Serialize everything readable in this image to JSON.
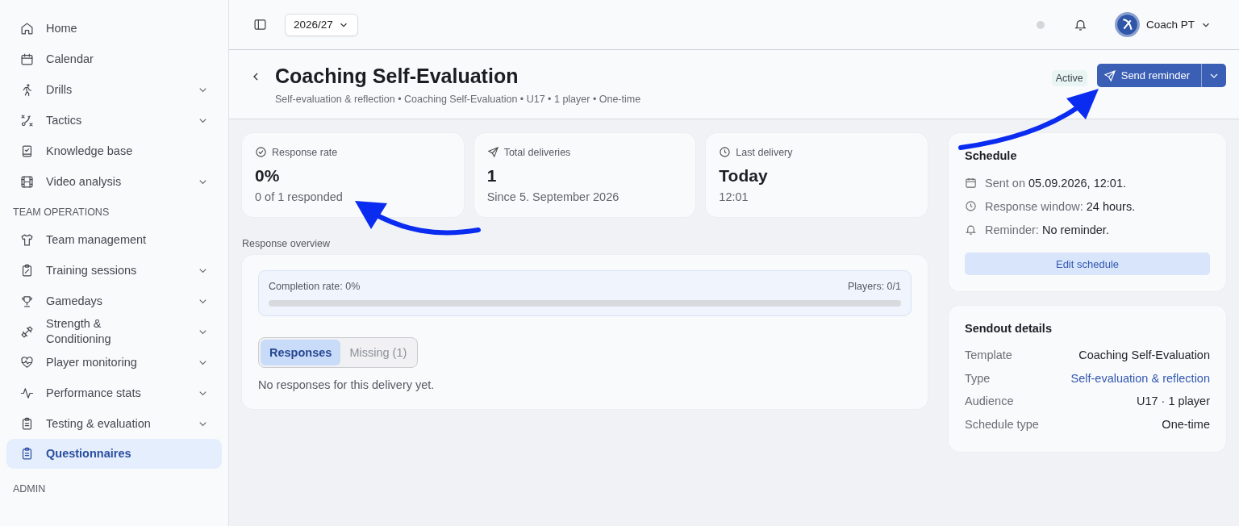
{
  "sidebar": {
    "sections": [
      {
        "items": [
          {
            "label": "Home",
            "expandable": false,
            "selected": false
          },
          {
            "label": "Calendar",
            "expandable": false,
            "selected": false
          },
          {
            "label": "Drills",
            "expandable": true,
            "selected": false
          },
          {
            "label": "Tactics",
            "expandable": true,
            "selected": false
          },
          {
            "label": "Knowledge base",
            "expandable": false,
            "selected": false
          },
          {
            "label": "Video analysis",
            "expandable": true,
            "selected": false
          }
        ]
      },
      {
        "title": "TEAM OPERATIONS",
        "items": [
          {
            "label": "Team management",
            "expandable": false,
            "selected": false
          },
          {
            "label": "Training sessions",
            "expandable": true,
            "selected": false
          },
          {
            "label": "Gamedays",
            "expandable": true,
            "selected": false
          },
          {
            "label": "Strength & Conditioning",
            "expandable": true,
            "selected": false
          },
          {
            "label": "Player monitoring",
            "expandable": true,
            "selected": false
          },
          {
            "label": "Performance stats",
            "expandable": true,
            "selected": false
          },
          {
            "label": "Testing & evaluation",
            "expandable": true,
            "selected": false
          },
          {
            "label": "Questionnaires",
            "expandable": false,
            "selected": true
          }
        ]
      },
      {
        "title": "ADMIN"
      }
    ]
  },
  "topbar": {
    "season": "2026/27",
    "user": "Coach PT"
  },
  "header": {
    "title": "Coaching Self-Evaluation",
    "subtitle": "Self-evaluation & reflection • Coaching Self-Evaluation • U17 • 1 player • One-time",
    "status": "Active",
    "action": "Send reminder"
  },
  "stats": [
    {
      "label": "Response rate",
      "value": "0%",
      "sub": "0 of 1 responded"
    },
    {
      "label": "Total deliveries",
      "value": "1",
      "sub": "Since 5. September 2026"
    },
    {
      "label": "Last delivery",
      "value": "Today",
      "sub": "12:01"
    }
  ],
  "overview": {
    "title": "Response overview",
    "completion": "Completion rate: 0%",
    "players": "Players: 0/1",
    "level": 0,
    "tabs": [
      {
        "label": "Responses",
        "selected": true
      },
      {
        "label": "Missing (1)",
        "selected": false
      }
    ],
    "empty": "No responses for this delivery yet."
  },
  "schedule": {
    "title": "Schedule",
    "items": [
      {
        "label": "Sent on",
        "value": "05.09.2026, 12:01."
      },
      {
        "label": "Response window:",
        "value": "24 hours."
      },
      {
        "label": "Reminder:",
        "value": "No reminder."
      }
    ],
    "button": "Edit schedule"
  },
  "details": {
    "title": "Sendout details",
    "rows": [
      {
        "label": "Template",
        "value": "Coaching Self-Evaluation",
        "link": false
      },
      {
        "label": "Type",
        "value": "Self-evaluation & reflection",
        "link": true
      },
      {
        "label": "Audience",
        "value": "U17 · 1 player",
        "link": false
      },
      {
        "label": "Schedule type",
        "value": "One-time",
        "link": false
      }
    ]
  }
}
